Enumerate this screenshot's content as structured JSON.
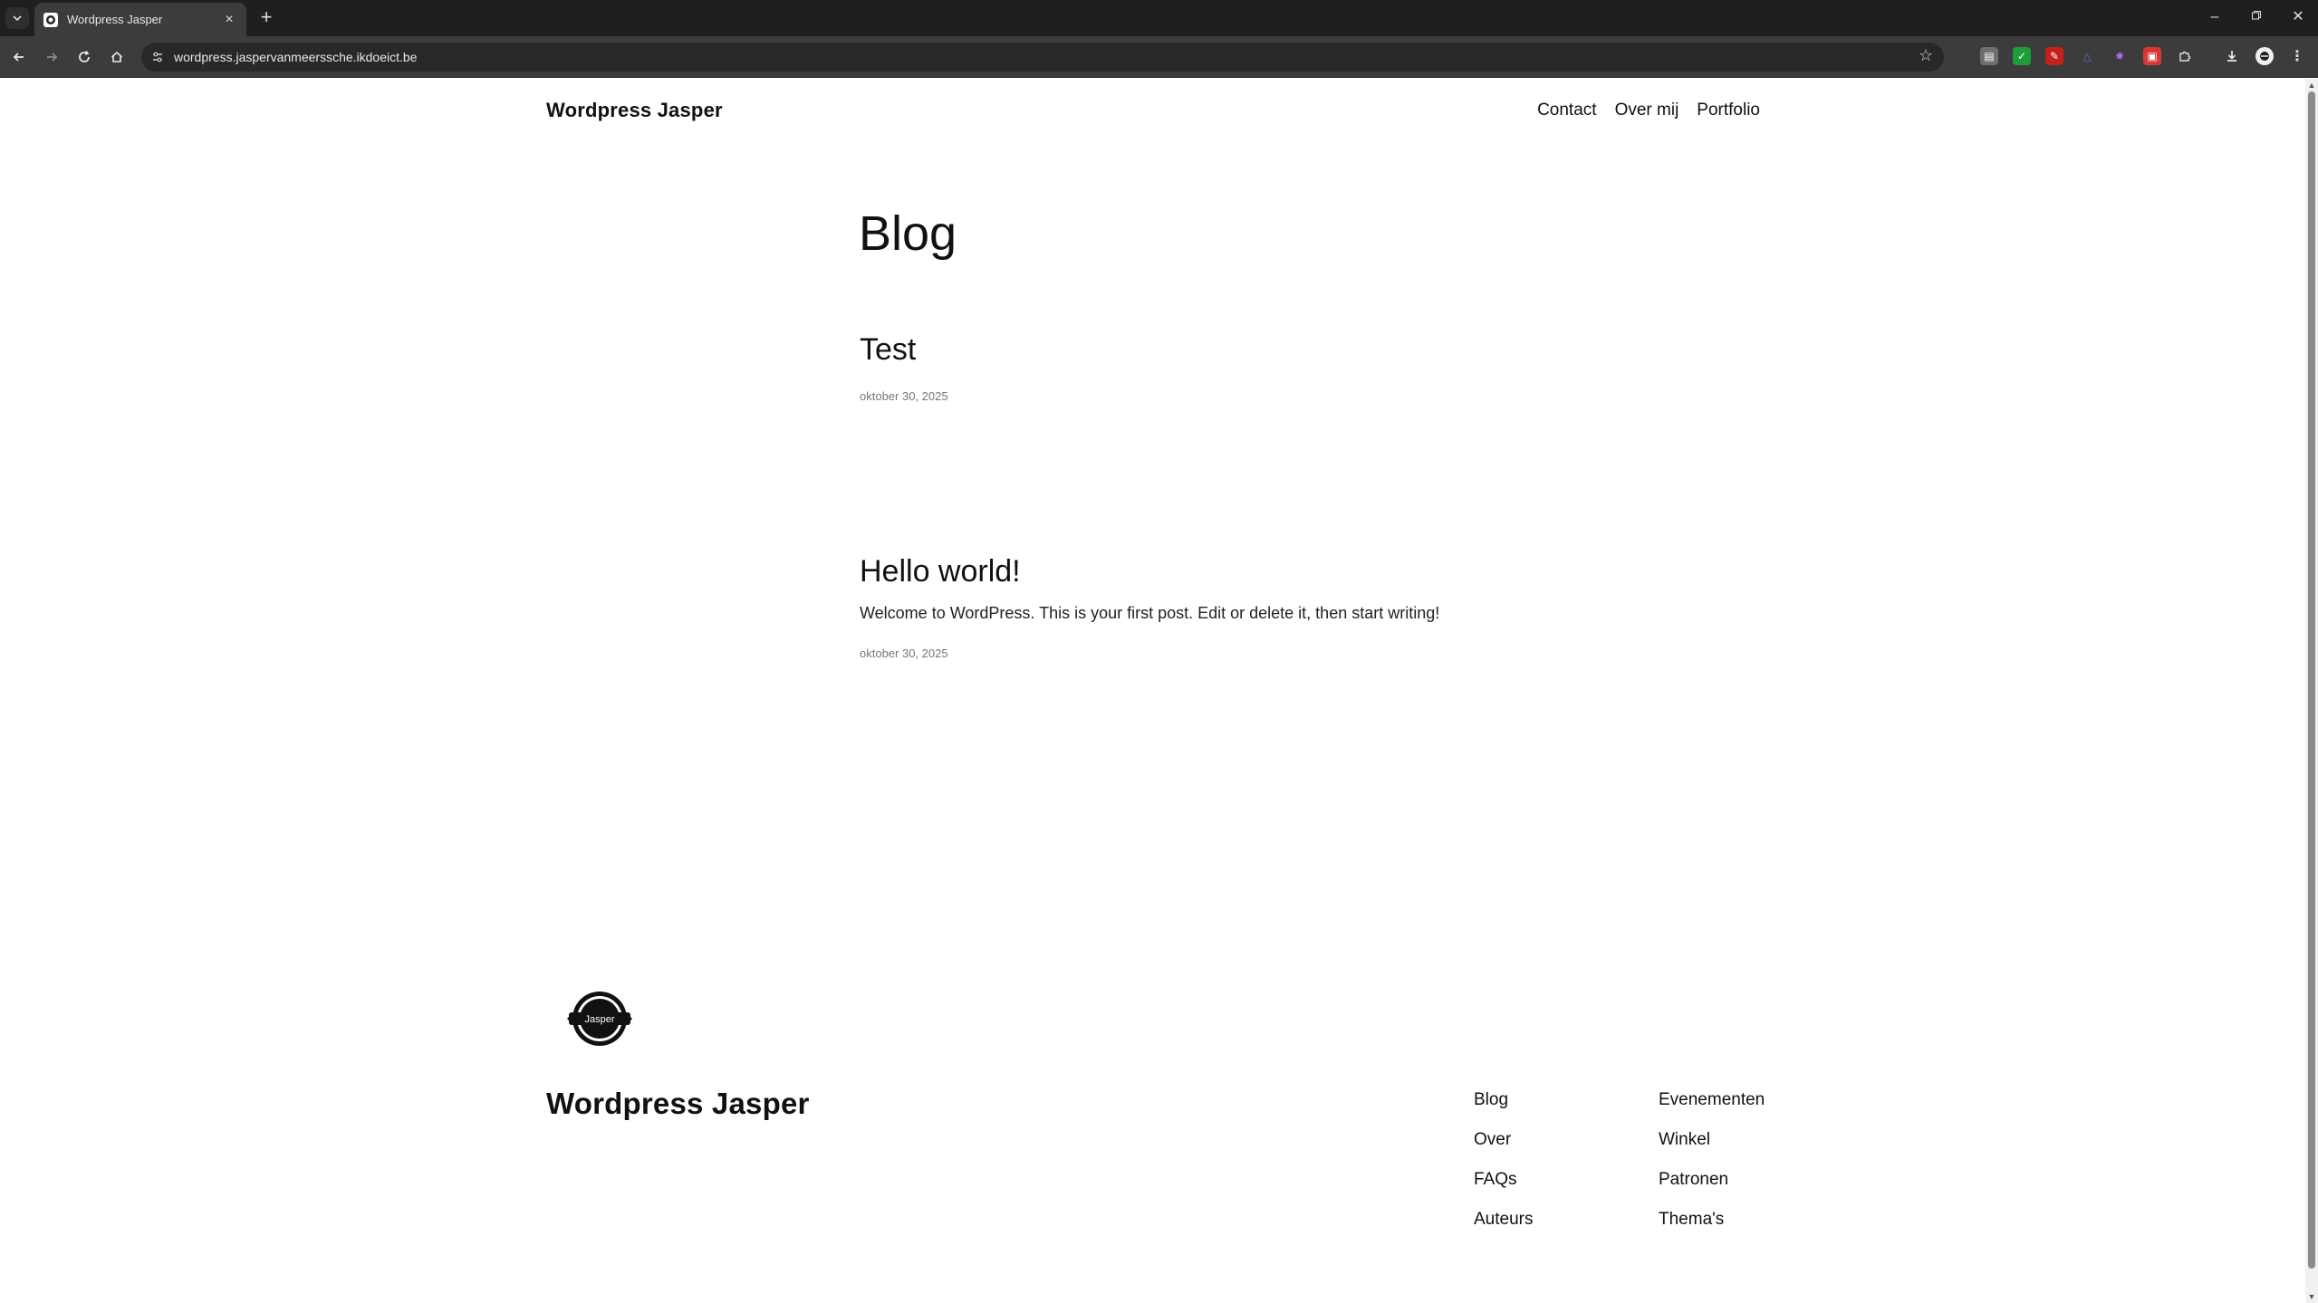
{
  "browser": {
    "tab_title": "Wordpress Jasper",
    "url": "wordpress.jaspervanmeerssche.ikdoeict.be"
  },
  "site": {
    "title": "Wordpress Jasper",
    "nav": [
      "Contact",
      "Over mij",
      "Portfolio"
    ]
  },
  "main": {
    "heading": "Blog",
    "posts": [
      {
        "title": "Test",
        "excerpt": "",
        "date": "oktober 30, 2025"
      },
      {
        "title": "Hello world!",
        "excerpt": "Welcome to WordPress. This is your first post. Edit or delete it, then start writing!",
        "date": "oktober 30, 2025"
      }
    ]
  },
  "footer": {
    "logo_text": "Jasper",
    "title": "Wordpress Jasper",
    "col1": [
      "Blog",
      "Over",
      "FAQs",
      "Auteurs"
    ],
    "col2": [
      "Evenementen",
      "Winkel",
      "Patronen",
      "Thema's"
    ]
  },
  "icons": {
    "back": "arrow-left-icon",
    "forward": "arrow-right-icon",
    "reload": "reload-icon",
    "home": "home-icon",
    "bookmark": "star-icon",
    "download": "download-icon",
    "profile": "profile-icon",
    "menu": "kebab-menu-icon"
  }
}
